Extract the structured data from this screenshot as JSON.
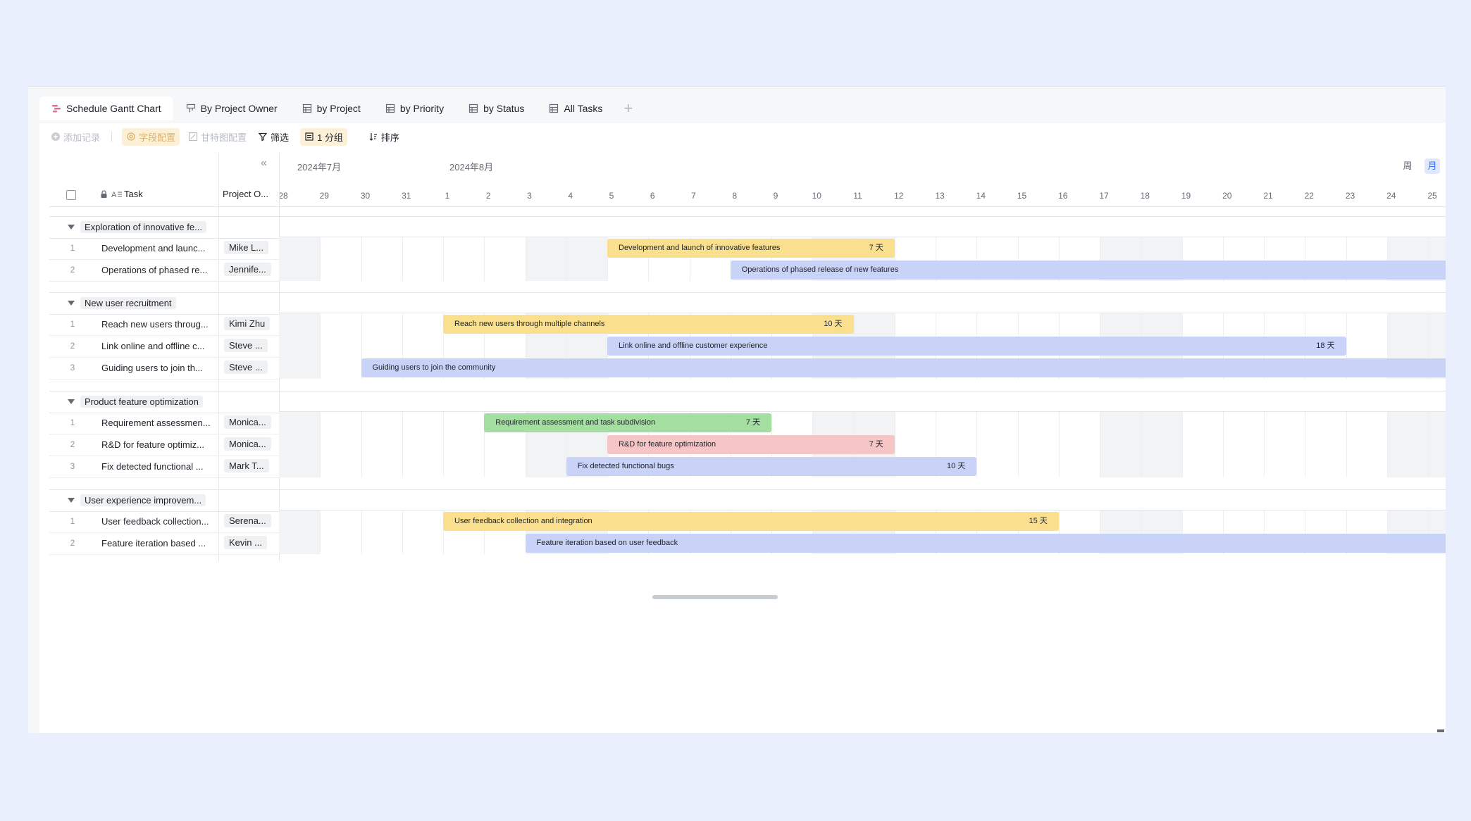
{
  "tabs": [
    {
      "label": "Schedule Gantt Chart",
      "icon": "gantt-icon",
      "active": true
    },
    {
      "label": "By Project Owner",
      "icon": "kanban-icon",
      "active": false
    },
    {
      "label": "by Project",
      "icon": "table-icon",
      "active": false
    },
    {
      "label": "by Priority",
      "icon": "table-icon",
      "active": false
    },
    {
      "label": "by Status",
      "icon": "table-icon",
      "active": false
    },
    {
      "label": "All Tasks",
      "icon": "table-icon",
      "active": false
    }
  ],
  "add_tab": "+",
  "toolbar": {
    "add_record": "添加记录",
    "field_config": "字段配置",
    "gantt_config": "甘特图配置",
    "filter": "筛选",
    "group": "1 分组",
    "sort": "排序"
  },
  "columns": {
    "task": "Task",
    "owner": "Project O..."
  },
  "collapse_icon": "«",
  "months": [
    {
      "label": "2024年7月"
    },
    {
      "label": "2024年8月"
    }
  ],
  "days": [
    "28",
    "29",
    "30",
    "31",
    "1",
    "2",
    "3",
    "4",
    "5",
    "6",
    "7",
    "8",
    "9",
    "10",
    "11",
    "12",
    "13",
    "14",
    "15",
    "16",
    "17",
    "18",
    "19",
    "20",
    "21",
    "22",
    "23",
    "24",
    "25"
  ],
  "view": {
    "week": "周",
    "month": "月",
    "active": "month"
  },
  "groups": [
    {
      "label": "Exploration of innovative fe...",
      "rows": [
        {
          "num": "1",
          "task": "Development and launc...",
          "owner": "Mike L...",
          "bar_label": "Development and launch of innovative features",
          "duration": "7 天",
          "color": "yellow",
          "start_day": "5",
          "end_day": "11"
        },
        {
          "num": "2",
          "task": "Operations of phased re...",
          "owner": "Jennife...",
          "bar_label": "Operations of phased release of new features",
          "duration": "",
          "color": "blue",
          "start_day": "8",
          "end_day": "25+"
        }
      ]
    },
    {
      "label": "New user recruitment",
      "rows": [
        {
          "num": "1",
          "task": "Reach new users throug...",
          "owner": "Kimi Zhu",
          "bar_label": "Reach new users through multiple channels",
          "duration": "10 天",
          "color": "yellow",
          "start_day": "1",
          "end_day": "10"
        },
        {
          "num": "2",
          "task": "Link online and offline c...",
          "owner": "Steve ...",
          "bar_label": "Link online and offline customer experience",
          "duration": "18 天",
          "color": "blue",
          "start_day": "5",
          "end_day": "22"
        },
        {
          "num": "3",
          "task": "Guiding users to join th...",
          "owner": "Steve ...",
          "bar_label": "Guiding users to join the community",
          "duration": "",
          "color": "blue",
          "start_day": "30",
          "end_day": "25+"
        }
      ]
    },
    {
      "label": "Product feature optimization",
      "rows": [
        {
          "num": "1",
          "task": "Requirement assessmen...",
          "owner": "Monica...",
          "bar_label": "Requirement assessment and task subdivision",
          "duration": "7 天",
          "color": "green",
          "start_day": "2",
          "end_day": "8"
        },
        {
          "num": "2",
          "task": "R&D for feature optimiz...",
          "owner": "Monica...",
          "bar_label": "R&D for feature optimization",
          "duration": "7 天",
          "color": "red",
          "start_day": "5",
          "end_day": "11"
        },
        {
          "num": "3",
          "task": "Fix detected functional ...",
          "owner": "Mark T...",
          "bar_label": "Fix detected functional bugs",
          "duration": "10 天",
          "color": "blue",
          "start_day": "4",
          "end_day": "13"
        }
      ]
    },
    {
      "label": "User experience improvem...",
      "rows": [
        {
          "num": "1",
          "task": "User feedback collection...",
          "owner": "Serena...",
          "bar_label": "User feedback collection and integration",
          "duration": "15 天",
          "color": "yellow",
          "start_day": "1",
          "end_day": "15"
        },
        {
          "num": "2",
          "task": "Feature iteration based ...",
          "owner": "Kevin ...",
          "bar_label": "Feature iteration based on user feedback",
          "duration": "",
          "color": "blue",
          "start_day": "3",
          "end_day": "25+"
        }
      ]
    }
  ],
  "colors": {
    "yellow": "#f9df8e",
    "blue": "#c9d2f7",
    "green": "#a4dea1",
    "red": "#f6c5c5",
    "accent": "#3370ff",
    "background": "#e9effc"
  }
}
